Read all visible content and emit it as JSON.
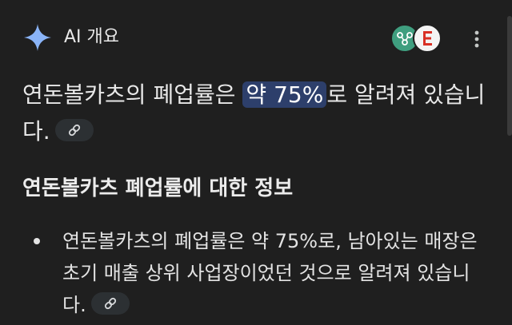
{
  "header": {
    "title": "AI 개요",
    "icons": {
      "sparkle": "gemini-sparkle-icon",
      "source_1": "source-favicon-green",
      "source_2": "source-favicon-red",
      "more": "more-vert-icon"
    }
  },
  "summary": {
    "text_before": "연돈볼카츠의 폐업률은 ",
    "highlight": "약 75%",
    "text_after": "로 알려져 있습니다.",
    "link_icon": "link-icon"
  },
  "section": {
    "heading": "연돈볼카츠 폐업률에 대한 정보"
  },
  "bullets": [
    {
      "text": "연돈볼카츠의 폐업률은 약 75%로, 남아있는 매장은 초기 매출 상위 사업장이었던 것으로 알려져 있습니다.",
      "link_icon": "link-icon"
    }
  ],
  "colors": {
    "background": "#1f1f1f",
    "text": "#e3e3e3",
    "highlight_bg": "#2d3f6b",
    "sparkle": "#8ab4f8",
    "chip_bg": "#2c3033"
  }
}
